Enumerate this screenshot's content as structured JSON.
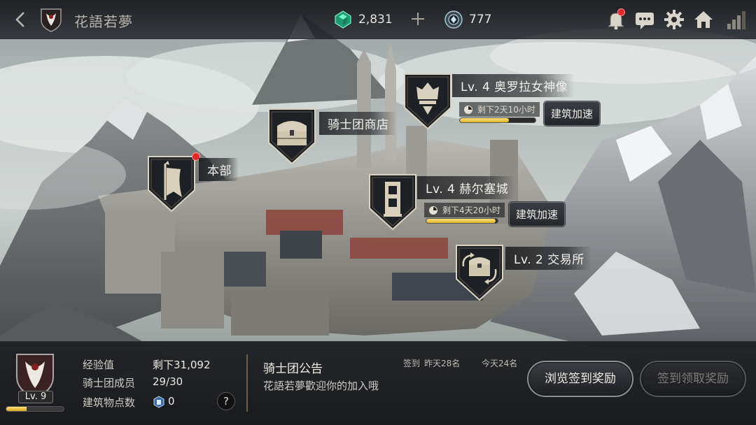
{
  "topbar": {
    "guild_name": "花語若夢",
    "gem_count": "2,831",
    "coin_count": "777",
    "icons": [
      "back-icon",
      "guild-emblem-icon",
      "gem-icon",
      "plus-icon",
      "coin-icon",
      "bell-icon",
      "chat-icon",
      "gear-icon",
      "home-icon",
      "signal-icon"
    ]
  },
  "buildings": {
    "shop": {
      "name": "骑士团商店"
    },
    "hq": {
      "name": "本部"
    },
    "goddess": {
      "name": "Lv. 4  奥罗拉女神像",
      "timer": "剩下2天10小时",
      "progress": 0.65,
      "speed_label": "建筑加速"
    },
    "castle": {
      "name": "Lv. 4  赫尔塞城",
      "timer": "剩下4天20小时",
      "progress": 0.97,
      "speed_label": "建筑加速"
    },
    "exchange": {
      "name": "Lv. 2  交易所"
    }
  },
  "panel": {
    "level": "Lv. 9",
    "level_progress": 0.35,
    "exp_label": "经验值",
    "exp_value": "剩下31,092",
    "members_label": "骑士团成员",
    "members_value": "29/30",
    "points_label": "建筑物点数",
    "points_value": "0",
    "help": "?",
    "notice_title": "骑士团公告",
    "notice_text": "花語若夢歡迎你的加入哦",
    "checkin_label": "签到",
    "yesterday": "昨天28名",
    "today": "今天24名",
    "browse_button": "浏览签到奖励",
    "claim_button": "签到领取奖励"
  },
  "colors": {
    "gold": "#e1b42a",
    "notification_red": "#e02a2a",
    "gem_green": "#2fd39a"
  }
}
